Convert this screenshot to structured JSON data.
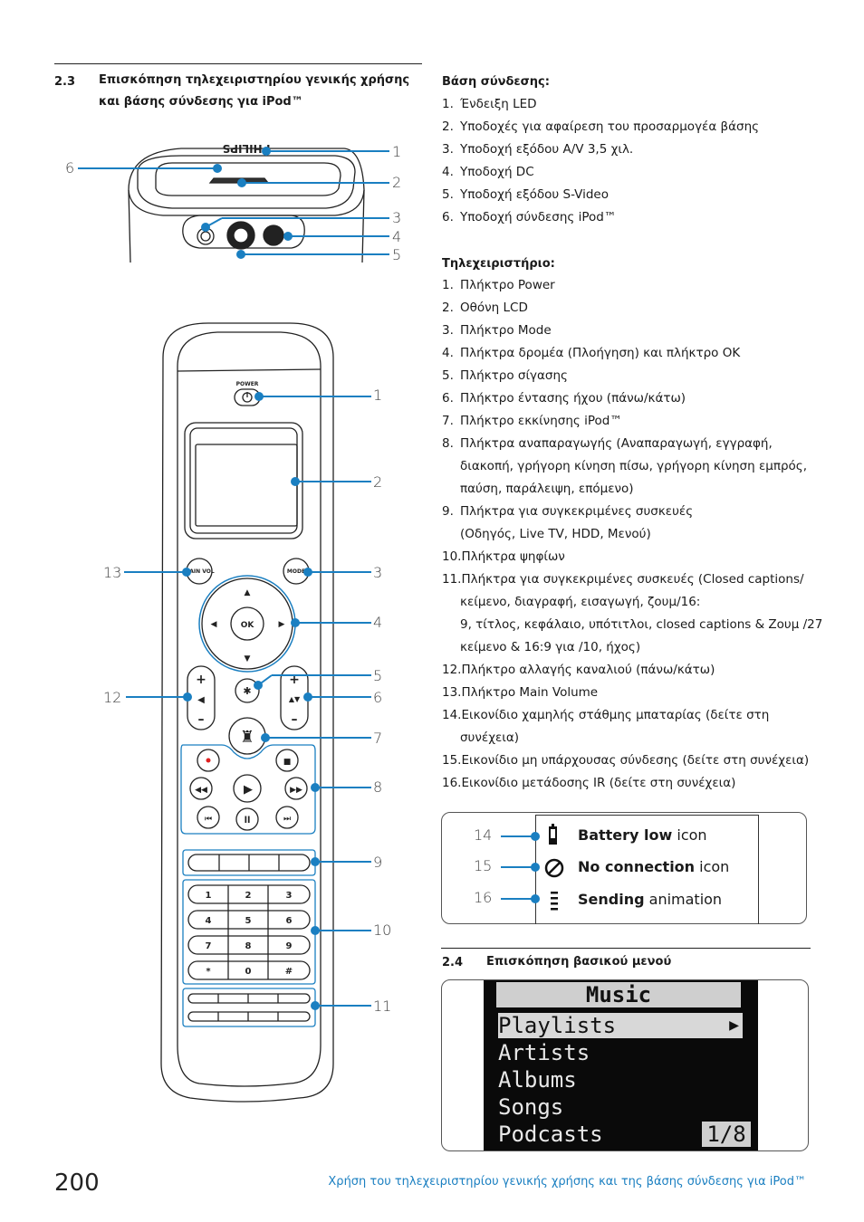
{
  "section_2_3": {
    "number": "2.3",
    "title_line1": "Επισκόπηση τηλεχειριστηρίου γενικής χρήσης",
    "title_line2": "και βάσης σύνδεσης για iPod™"
  },
  "dock_diagram": {
    "brand": "PHILIPS",
    "callouts": [
      "1",
      "2",
      "3",
      "4",
      "5",
      "6"
    ]
  },
  "remote_diagram": {
    "power_label": "POWER",
    "main_vol_label": "MAIN VOL",
    "mode_label": "MODE",
    "ok_label": "OK",
    "keypad": [
      "1",
      "2",
      "3",
      "4",
      "5",
      "6",
      "7",
      "8",
      "9",
      "*",
      "0",
      "#"
    ],
    "callouts_right": [
      "1",
      "2",
      "3",
      "4",
      "5",
      "6",
      "7",
      "8",
      "9",
      "10",
      "11"
    ],
    "callouts_left": [
      "13",
      "12"
    ]
  },
  "dock_list": {
    "heading": "Βάση σύνδεσης:",
    "items": [
      {
        "n": "1.",
        "text": "Ένδειξη LED"
      },
      {
        "n": "2.",
        "text": "Υποδοχές για αφαίρεση του προσαρμογέα βάσης"
      },
      {
        "n": "3.",
        "text": "Υποδοχή εξόδου A/V 3,5 χιλ."
      },
      {
        "n": "4.",
        "text": "Υποδοχή DC"
      },
      {
        "n": "5.",
        "text": "Υποδοχή εξόδου S-Video"
      },
      {
        "n": "6.",
        "text": "Υποδοχή σύνδεσης iPod™"
      }
    ]
  },
  "remote_list": {
    "heading": "Τηλεχειριστήριο:",
    "items": [
      {
        "n": "1.",
        "text": "Πλήκτρο Power"
      },
      {
        "n": "2.",
        "text": "Οθόνη LCD"
      },
      {
        "n": "3.",
        "text": "Πλήκτρο Mode"
      },
      {
        "n": "4.",
        "text": "Πλήκτρα δρομέα (Πλοήγηση) και πλήκτρο OK"
      },
      {
        "n": "5.",
        "text": "Πλήκτρο σίγασης"
      },
      {
        "n": "6.",
        "text": "Πλήκτρο έντασης ήχου (πάνω/κάτω)"
      },
      {
        "n": "7.",
        "text": "Πλήκτρο εκκίνησης iPod™"
      },
      {
        "n": "8.",
        "text": "Πλήκτρα αναπαραγωγής (Αναπαραγωγή, εγγραφή,",
        "cont": [
          "διακοπή, γρήγορη κίνηση πίσω, γρήγορη κίνηση εμπρός,",
          "παύση, παράλειψη, επόμενο)"
        ]
      },
      {
        "n": "9.",
        "text": "Πλήκτρα για συγκεκριμένες συσκευές",
        "cont": [
          "(Οδηγός, Live TV, HDD, Μενού)"
        ]
      },
      {
        "n": "10.",
        "text": "Πλήκτρα ψηφίων"
      },
      {
        "n": "11.",
        "text": "Πλήκτρα για συγκεκριμένες συσκευές (Closed captions/",
        "cont": [
          "κείμενο, διαγραφή, εισαγωγή, ζουμ/16:",
          "9, τίτλος, κεφάλαιο, υπότιτλοι, closed captions & Ζουμ /27",
          "κείμενο & 16:9 για /10, ήχος)"
        ]
      },
      {
        "n": "12.",
        "text": "Πλήκτρο αλλαγής καναλιού (πάνω/κάτω)"
      },
      {
        "n": "13.",
        "text": "Πλήκτρο Main Volume"
      },
      {
        "n": "14.",
        "text": "Εικονίδιο χαμηλής στάθμης μπαταρίας (δείτε στη",
        "cont": [
          "συνέχεια)"
        ]
      },
      {
        "n": "15.",
        "text": "Εικονίδιο μη υπάρχουσας σύνδεσης (δείτε στη συνέχεια)"
      },
      {
        "n": "16.",
        "text": "Εικονίδιο μετάδοσης IR (δείτε στη συνέχεια)"
      }
    ]
  },
  "icon_legend": [
    {
      "num": "14",
      "bold": "Battery low",
      "rest": " icon",
      "icon": "battery-low-icon"
    },
    {
      "num": "15",
      "bold": "No connection",
      "rest": " icon",
      "icon": "no-connection-icon"
    },
    {
      "num": "16",
      "bold": "Sending",
      "rest": " animation",
      "icon": "sending-animation-icon"
    }
  ],
  "section_2_4": {
    "number": "2.4",
    "title": "Επισκόπηση βασικού μενού"
  },
  "music_menu": {
    "title": "Music",
    "items": [
      "Playlists",
      "Artists",
      "Albums",
      "Songs",
      "Podcasts"
    ],
    "selected_index": 0,
    "page_indicator": "1/8"
  },
  "footer": {
    "page_number": "200",
    "running_title": "Χρήση του τηλεχειριστηρίου γενικής χρήσης και της βάσης σύνδεσης για iPod™"
  },
  "colors": {
    "callout_blue": "#1a7fc1",
    "record_red": "#e02020"
  }
}
